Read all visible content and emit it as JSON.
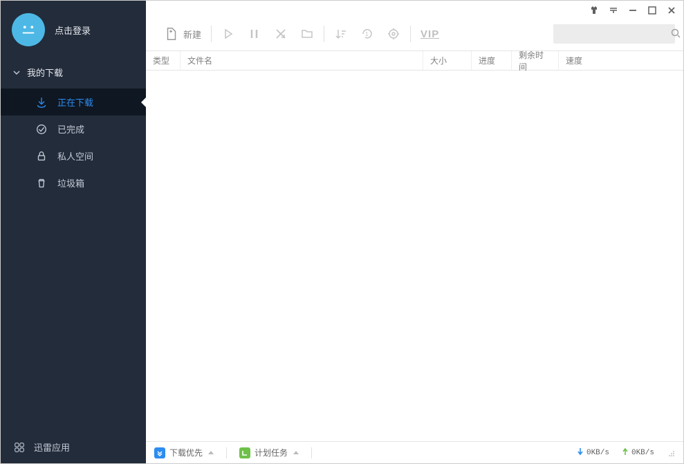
{
  "user": {
    "login_label": "点击登录"
  },
  "sidebar": {
    "section_label": "我的下载",
    "items": [
      {
        "label": "正在下载",
        "active": true
      },
      {
        "label": "已完成",
        "active": false
      },
      {
        "label": "私人空间",
        "active": false
      },
      {
        "label": "垃圾箱",
        "active": false
      }
    ],
    "footer_label": "迅雷应用"
  },
  "toolbar": {
    "new_label": "新建"
  },
  "columns": {
    "type": "类型",
    "filename": "文件名",
    "size": "大小",
    "progress": "进度",
    "remaining": "剩余时间",
    "speed": "速度"
  },
  "statusbar": {
    "priority_label": "下载优先",
    "schedule_label": "计划任务",
    "down_speed": "0KB/s",
    "up_speed": "0KB/s"
  },
  "search": {
    "placeholder": ""
  }
}
